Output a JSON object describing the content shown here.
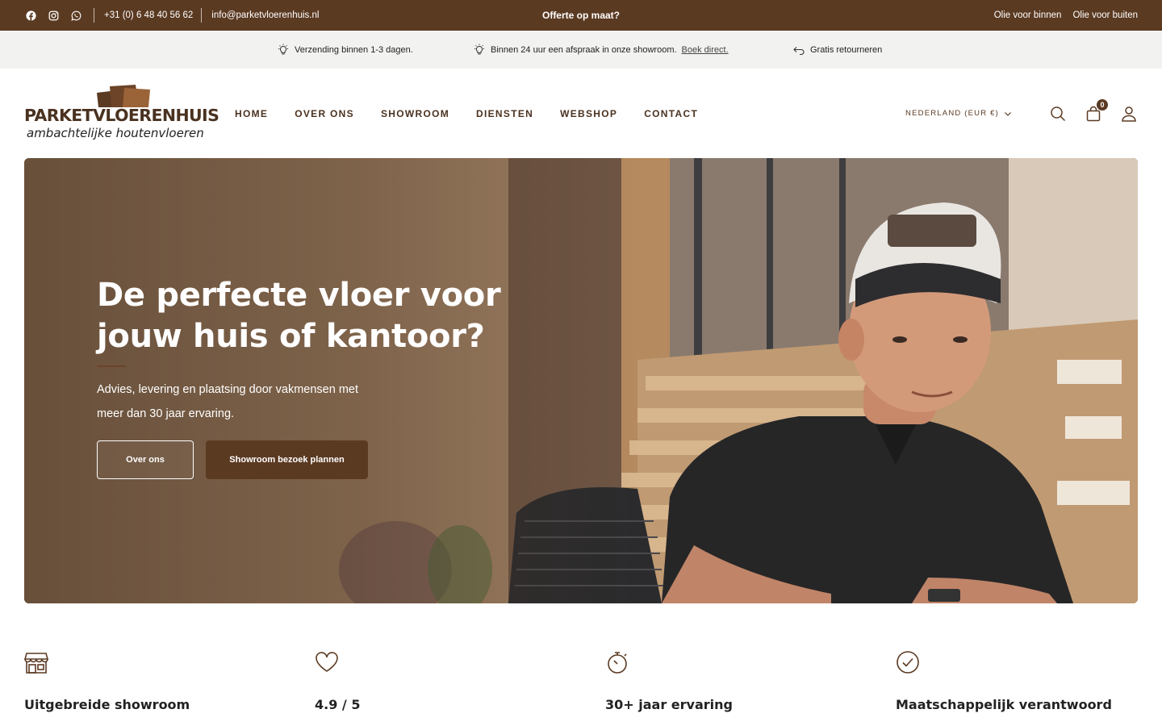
{
  "topbar": {
    "socials": [
      {
        "icon": "facebook-icon"
      },
      {
        "icon": "instagram-icon"
      },
      {
        "icon": "whatsapp-icon"
      }
    ],
    "phone": "+31 (0) 6 48 40 56 62",
    "email": "info@parketvloerenhuis.nl",
    "promo": "Offerte op maat?",
    "links": [
      "Olie voor binnen",
      "Olie voor buiten"
    ]
  },
  "usps": [
    {
      "icon": "lightbulb-icon",
      "text": "Verzending binnen 1-3 dagen."
    },
    {
      "icon": "lightbulb-icon",
      "text": "Binnen 24 uur een afspraak in onze showroom.",
      "link": "Boek direct."
    },
    {
      "icon": "return-arrow-icon",
      "text": "Gratis retourneren"
    }
  ],
  "header": {
    "logo_brand": "PARKETVLOERENHUIS",
    "logo_tagline": "ambachtelijke houtenvloeren",
    "nav": [
      "HOME",
      "OVER ONS",
      "SHOWROOM",
      "DIENSTEN",
      "WEBSHOP",
      "CONTACT"
    ],
    "country": "NEDERLAND (EUR €)",
    "cart_count": "0"
  },
  "hero": {
    "title": "De perfecte vloer voor jouw huis of kantoor?",
    "subtitle": "Advies, levering en plaatsing door vakmensen met meer dan 30 jaar ervaring.",
    "button_secondary": "Over ons",
    "button_primary": "Showroom bezoek plannen"
  },
  "features": [
    {
      "icon": "storefront-icon",
      "title": "Uitgebreide showroom"
    },
    {
      "icon": "heart-icon",
      "title": "4.9 / 5"
    },
    {
      "icon": "stopwatch-icon",
      "title": "30+ jaar ervaring"
    },
    {
      "icon": "checkmark-circle-icon",
      "title": "Maatschappelijk verantwoord"
    }
  ],
  "colors": {
    "brand_brown": "#5b3a22",
    "usp_background": "#f2f2f1",
    "nav_text": "#4a3220"
  }
}
